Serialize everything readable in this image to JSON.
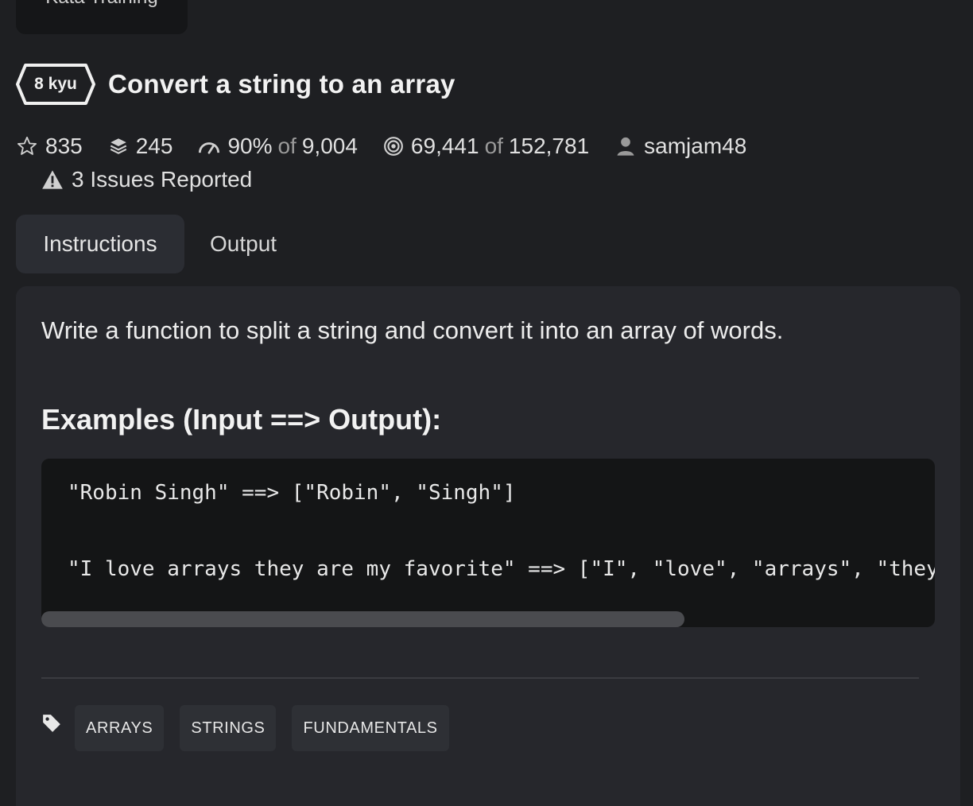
{
  "header": {
    "training_button_label": "Kata Training"
  },
  "kata": {
    "rank": "8 kyu",
    "title": "Convert a string to an array"
  },
  "stats": {
    "stars": "835",
    "collections": "245",
    "satisfaction_percent": "90%",
    "satisfaction_of": "of",
    "satisfaction_votes": "9,004",
    "completed": "69,441",
    "completed_of": "of",
    "attempted": "152,781",
    "author": "samjam48",
    "issues": "3 Issues Reported"
  },
  "tabs": [
    {
      "label": "Instructions",
      "active": true
    },
    {
      "label": "Output",
      "active": false
    }
  ],
  "instructions": {
    "description": "Write a function to split a string and convert it into an array of words.",
    "examples_heading": "Examples (Input ==> Output):",
    "code_lines": [
      "\"Robin Singh\" ==> [\"Robin\", \"Singh\"]",
      "\"I love arrays they are my favorite\" ==> [\"I\", \"love\", \"arrays\", \"they\", \"are\", \"my\", \"favorite\"]"
    ],
    "code_scroll_visible_fraction": 0.72
  },
  "tags": [
    "ARRAYS",
    "STRINGS",
    "FUNDAMENTALS"
  ],
  "colors": {
    "background": "#1e1f22",
    "panel": "#26272c",
    "code_background": "#141516"
  },
  "icons": [
    "star-icon",
    "collection-icon",
    "gauge-icon",
    "target-icon",
    "user-icon",
    "warning-icon",
    "tag-icon"
  ]
}
